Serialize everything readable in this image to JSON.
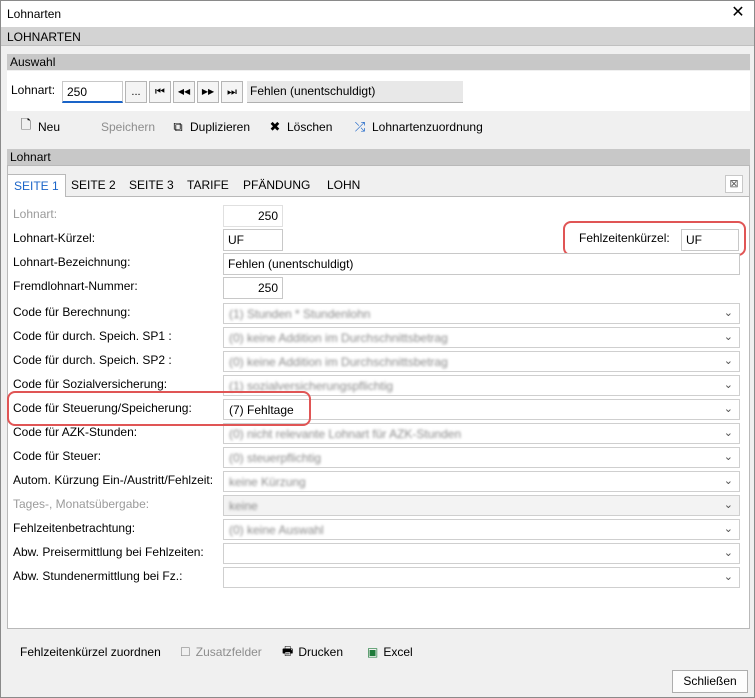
{
  "window": {
    "title": "Lohnarten",
    "close_glyph": "✕"
  },
  "app_header": "LOHNARTEN",
  "auswahl": {
    "section_title": "Auswahl",
    "lohnart_label": "Lohnart:",
    "lohnart_value": "250",
    "browse_label": "...",
    "first_glyph": "⏮",
    "prev_glyph": "◀◀",
    "next_glyph": "▶▶",
    "last_glyph": "⏭",
    "description": "Fehlen (unentschuldigt)"
  },
  "toolbar": {
    "new_label": "Neu",
    "save_label": "Speichern",
    "duplicate_label": "Duplizieren",
    "delete_label": "Löschen",
    "mapping_label": "Lohnartenzuordnung"
  },
  "lohnart_section_title": "Lohnart",
  "tabs": [
    "SEITE 1",
    "SEITE 2",
    "SEITE 3",
    "TARIFE",
    "PFÄNDUNG",
    "LOHN"
  ],
  "form": {
    "lohnart_label": "Lohnart:",
    "lohnart_value": "250",
    "kuerzel_label": "Lohnart-Kürzel:",
    "kuerzel_value": "UF",
    "fehlzeiten_kuerzel_label": "Fehlzeitenkürzel:",
    "fehlzeiten_kuerzel_value": "UF",
    "bezeichnung_label": "Lohnart-Bezeichnung:",
    "bezeichnung_value": "Fehlen (unentschuldigt)",
    "fremd_label": "Fremdlohnart-Nummer:",
    "fremd_value": "250",
    "combos": [
      {
        "label": "Code für Berechnung:",
        "value": "(1) Stunden * Stundenlohn",
        "blurred": true
      },
      {
        "label": "Code für durch. Speich. SP1 :",
        "value": "(0) keine Addition im Durchschnittsbetrag",
        "blurred": true
      },
      {
        "label": "Code für durch. Speich. SP2 :",
        "value": "(0) keine Addition im Durchschnittsbetrag",
        "blurred": true
      },
      {
        "label": "Code für Sozialversicherung:",
        "value": "(1) sozialversicherungspflichtig",
        "blurred": true
      },
      {
        "label": "Code für Steuerung/Speicherung:",
        "value": "(7) Fehltage",
        "blurred": false
      },
      {
        "label": "Code für AZK-Stunden:",
        "value": "(0) nicht relevante Lohnart für AZK-Stunden",
        "blurred": true
      },
      {
        "label": "Code für Steuer:",
        "value": "(0) steuerpflichtig",
        "blurred": true
      },
      {
        "label": "Autom. Kürzung Ein-/Austritt/Fehlzeit:",
        "value": "keine Kürzung",
        "blurred": true
      },
      {
        "label": "Tages-, Monatsübergabe:",
        "value": "keine",
        "blurred": true,
        "disabled": true
      },
      {
        "label": "Fehlzeitenbetrachtung:",
        "value": "(0) keine Auswahl",
        "blurred": true
      },
      {
        "label": "Abw. Preisermittlung bei Fehlzeiten:",
        "value": "",
        "blurred": false
      },
      {
        "label": "Abw. Stundenermittlung bei Fz.:",
        "value": "",
        "blurred": false
      }
    ]
  },
  "bottom": {
    "fehlzeiten_zuordnen": "Fehlzeitenkürzel zuordnen",
    "zusatzfelder": "Zusatzfelder",
    "drucken": "Drucken",
    "excel": "Excel",
    "schliessen": "Schließen"
  },
  "colors": {
    "highlight": "#e05555",
    "active_tab": "#1a64c8"
  }
}
